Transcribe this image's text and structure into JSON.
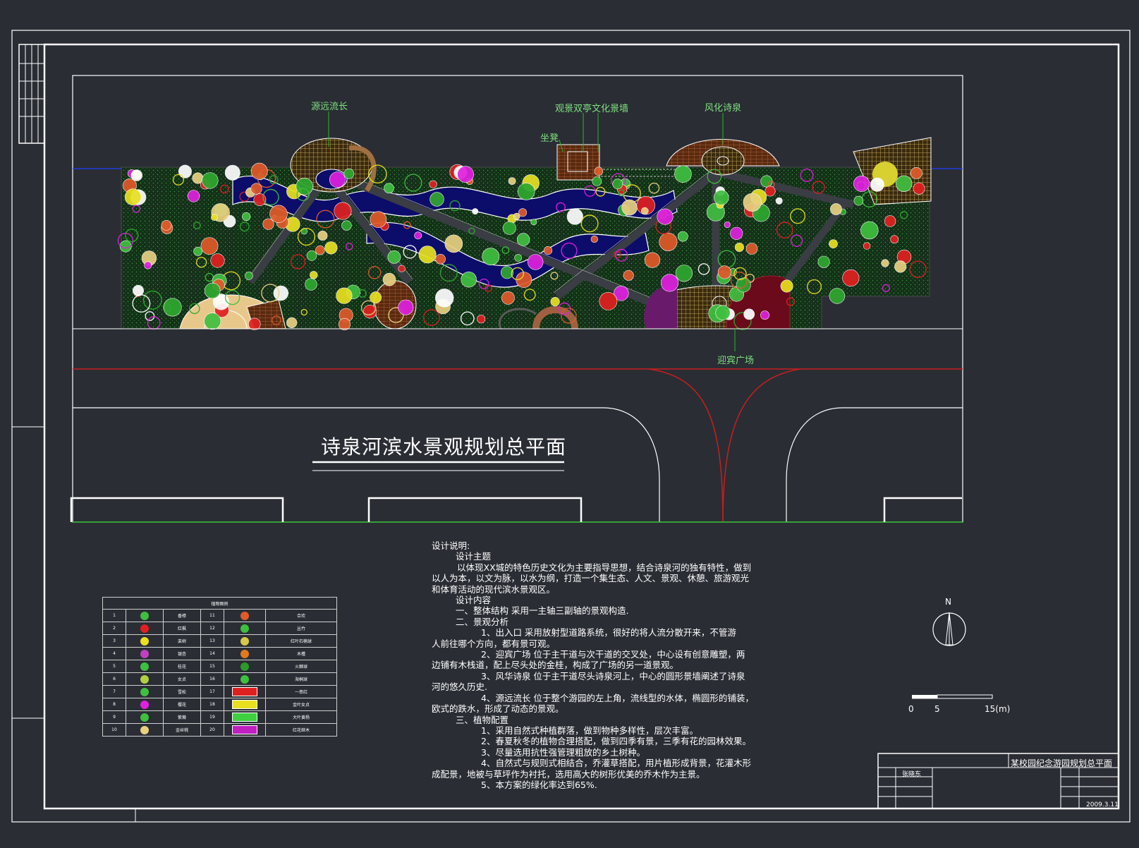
{
  "drawing_title": "诗泉河滨水景观规划总平面",
  "callouts": {
    "source": "源远流长",
    "pavilion": "观景双亭文化景墙",
    "spring": "风化诗泉",
    "bench": "坐凳",
    "plaza": "迎宾广场"
  },
  "notes": [
    "设计说明:",
    "设计主题",
    "以体现XX城的特色历史文化为主要指导思想，结合诗泉河的独有特性，做到",
    "以人为本，以文为脉，以水为纲，打造一个集生态、人文、景观、休憩、旅游观光",
    "和体育活动的现代滨水景观区。",
    "设计内容",
    "一、整体结构        采用一主轴三副轴的景观构造.",
    "二、景观分析",
    "1、出入口      采用放射型道路系统，很好的将人流分散开来，不管游",
    "人前往哪个方向，都有景可观。",
    "2、迎宾广场     位于主干道与次干道的交叉处，中心设有创意雕塑，两",
    "边铺有木栈道，配上尽头处的金桂，构成了广场的另一道景观。",
    "3、风华诗泉     位于主干道尽头诗泉河上，中心的圆形景墙阐述了诗泉",
    "河的悠久历史.",
    "4、源远流长     位于整个游园的左上角，流线型的水体，椭圆形的铺装，",
    "欧式的跌水，形成了动态的景观。",
    "三、植物配置",
    "1、采用自然式种植群落，做到物种多样性，层次丰富。",
    "2、春夏秋冬的植物合理搭配，做到四季有景，三季有花的园林效果。",
    "3、尽量选用抗性强管理粗放的乡土树种。",
    "4、自然式与规则式相结合，乔灌草搭配，用片植形成背景，花灌木形",
    "成配景，地被与草坪作为衬托，选用高大的树形优美的乔木作为主景。",
    "5、本方案的绿化率达到65%."
  ],
  "legend": {
    "title": "植物图例",
    "rows": [
      {
        "n1": "1",
        "c1": "#3fbf3f",
        "name1": "香樟",
        "n2": "11",
        "c2": "#e05a2a",
        "name2": "合欢"
      },
      {
        "n1": "2",
        "c1": "#e02020",
        "name1": "红枫",
        "n2": "12",
        "c2": "#3fbf3f",
        "name2": "丛竹"
      },
      {
        "n1": "3",
        "c1": "#e8e020",
        "name1": "栾树",
        "n2": "13",
        "c2": "#d8c84a",
        "name2": "红叶石楠球"
      },
      {
        "n1": "4",
        "c1": "#c040c0",
        "name1": "银杏",
        "n2": "14",
        "c2": "#e07a20",
        "name2": "木槿"
      },
      {
        "n1": "5",
        "c1": "#3fbf3f",
        "name1": "桂花",
        "n2": "15",
        "c2": "#2a9a2a",
        "name2": "火棘球"
      },
      {
        "n1": "6",
        "c1": "#b0d040",
        "name1": "女贞",
        "n2": "16",
        "c2": "#3fbf3f",
        "name2": "海桐球"
      },
      {
        "n1": "7",
        "c1": "#3fbf3f",
        "name1": "雪松",
        "n2": "17",
        "c2": "#e02020",
        "name2": "一串红"
      },
      {
        "n1": "8",
        "c1": "#e020e0",
        "name1": "樱花",
        "n2": "18",
        "c2": "#e8e020",
        "name2": "金叶女贞"
      },
      {
        "n1": "9",
        "c1": "#3fbf3f",
        "name1": "紫薇",
        "n2": "19",
        "c2": "#3fd03f",
        "name2": "大叶黄杨"
      },
      {
        "n1": "10",
        "c1": "#e8d080",
        "name1": "金丝桃",
        "n2": "20",
        "c2": "#c020c0",
        "name2": "红花继木"
      }
    ]
  },
  "north_label": "N",
  "scale": {
    "l0": "0",
    "l5": "5",
    "l15": "15(m)"
  },
  "title_block": {
    "project": "某校园纪念游园规划总平面",
    "designer": "张晓东",
    "date": "2009.3.11"
  },
  "colors": {
    "background": "#2a2d34",
    "line": "#ffffff",
    "road_center": "#c81e1e",
    "label": "#7ee07e",
    "water": "#1a1a8a",
    "grass": "#1f3a1f"
  }
}
